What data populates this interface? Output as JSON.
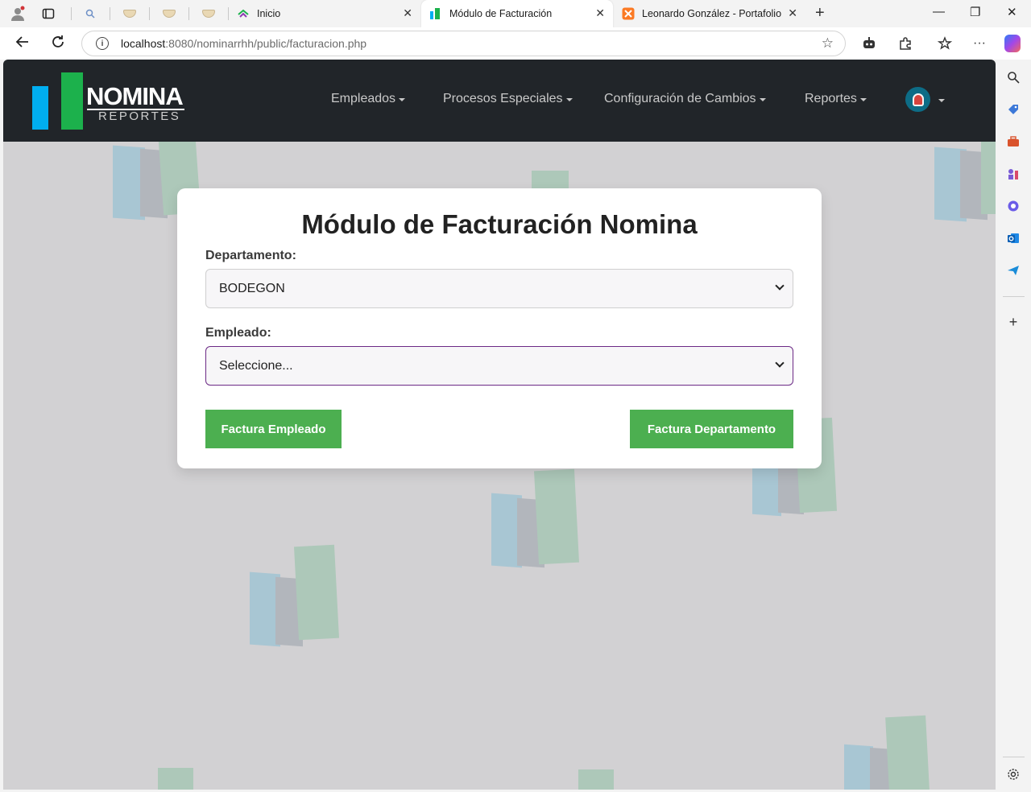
{
  "browser": {
    "tabs": [
      {
        "title": "Inicio",
        "active": false
      },
      {
        "title": "Módulo de Facturación",
        "active": true
      },
      {
        "title": "Leonardo González - Portafolio",
        "active": false
      }
    ],
    "url_host": "localhost",
    "url_rest": ":8080/nominarrhh/public/facturacion.php"
  },
  "app": {
    "logo": {
      "brand": "NOMINA",
      "subtitle": "REPORTES"
    },
    "menu": [
      {
        "label": "Empleados"
      },
      {
        "label": "Procesos Especiales"
      },
      {
        "label": "Configuración de Cambios"
      },
      {
        "label": "Reportes"
      }
    ]
  },
  "form": {
    "title": "Módulo de Facturación Nomina",
    "departamento_label": "Departamento:",
    "departamento_value": "BODEGON",
    "empleado_label": "Empleado:",
    "empleado_value": "Seleccione...",
    "btn_empleado": "Factura Empleado",
    "btn_departamento": "Factura Departamento"
  },
  "colors": {
    "nav_bg": "#212529",
    "page_bg": "#d2d1d3",
    "button_green": "#4caf50",
    "logo_blue": "#00aef0",
    "logo_green": "#1cb14c",
    "focus_border": "#6c2a86"
  }
}
